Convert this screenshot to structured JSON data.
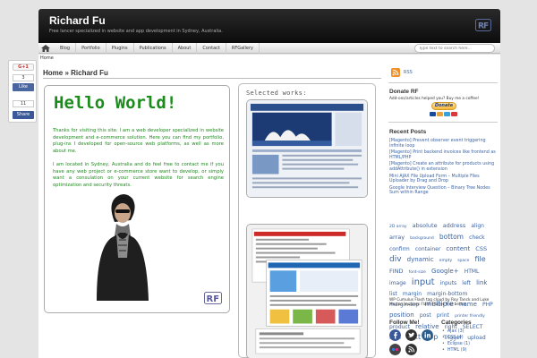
{
  "header": {
    "title": "Richard Fu",
    "tagline": "Free lancer specialized in website and app development in Sydney, Australia."
  },
  "nav": {
    "items": [
      "Blog",
      "Portfolio",
      "Plugins",
      "Publications",
      "About",
      "Contact",
      "RFGallery"
    ],
    "search_placeholder": "Type text to search here..."
  },
  "breadcrumb": {
    "small": "Home"
  },
  "share": {
    "gplus_label": "G+1",
    "gplus_count": "3",
    "like_label": "Like",
    "like_count": "11",
    "share_label": "Share"
  },
  "main": {
    "heading": "Home » Richard Fu",
    "hello_title": "Hello World!",
    "paragraph1": "Thanks for visiting this site. I am a web developer specialized in website development and e-commerce solution. Here you can find my portfolio, plug-ins I developed for open-source web platforms, as well as more about me.",
    "paragraph2": "I am located in Sydney, Australia and do feel free to contact me if you have any web project or e-commerce store want to develop, or simply want a consulation on your current website for search engine optimization and security threats."
  },
  "works": {
    "title": "Selected works:"
  },
  "sidebar": {
    "rss_label": "RSS",
    "donate_title": "Donate RF",
    "donate_sub": "Add-ons/articles helped you? Buy me a coffee!",
    "donate_button": "Donate",
    "recent_title": "Recent Posts",
    "recent_posts": [
      "[Magento] Prevent observer event triggering infinite loop",
      "[Magento] Print backend invoices like frontend as HTML/PHP",
      "[Magento] Create an attribute for products using addAttribute() in extension",
      "Mini AJAX File Upload Form – Multiple Files Uploader by Drag and Drop",
      "Google Interview Question – Binary Tree Nodes Sum within Range"
    ],
    "tags": [
      {
        "t": "2D array",
        "s": 4.5
      },
      {
        "t": "absolute",
        "s": 6.5
      },
      {
        "t": "address",
        "s": 6.5
      },
      {
        "t": "align",
        "s": 6
      },
      {
        "t": "array",
        "s": 6.5
      },
      {
        "t": "background",
        "s": 4.5
      },
      {
        "t": "bottom",
        "s": 7.5
      },
      {
        "t": "check",
        "s": 6
      },
      {
        "t": "confirm",
        "s": 6
      },
      {
        "t": "container",
        "s": 6
      },
      {
        "t": "content",
        "s": 7
      },
      {
        "t": "CSS",
        "s": 6.5
      },
      {
        "t": "div",
        "s": 9
      },
      {
        "t": "dynamic",
        "s": 7
      },
      {
        "t": "empty",
        "s": 4.5
      },
      {
        "t": "space",
        "s": 4.5
      },
      {
        "t": "file",
        "s": 8
      },
      {
        "t": "FIND",
        "s": 6.5
      },
      {
        "t": "font-size",
        "s": 4.5
      },
      {
        "t": "Google+",
        "s": 7
      },
      {
        "t": "HTML",
        "s": 6
      },
      {
        "t": "image",
        "s": 6
      },
      {
        "t": "input",
        "s": 10
      },
      {
        "t": "inputs",
        "s": 6
      },
      {
        "t": "left",
        "s": 6
      },
      {
        "t": "link",
        "s": 7
      },
      {
        "t": "list",
        "s": 6
      },
      {
        "t": "margin",
        "s": 6
      },
      {
        "t": "margin-bottom",
        "s": 6
      },
      {
        "t": "margin-top",
        "s": 6
      },
      {
        "t": "multiple",
        "s": 8
      },
      {
        "t": "name",
        "s": 7
      },
      {
        "t": "PHP",
        "s": 6
      },
      {
        "t": "position",
        "s": 7
      },
      {
        "t": "post",
        "s": 6
      },
      {
        "t": "print",
        "s": 6
      },
      {
        "t": "printer friendly",
        "s": 4.5
      },
      {
        "t": "product",
        "s": 6
      },
      {
        "t": "relative",
        "s": 7
      },
      {
        "t": "right",
        "s": 6
      },
      {
        "t": "SELECT",
        "s": 6
      },
      {
        "t": "space",
        "s": 4.5
      },
      {
        "t": "text",
        "s": 8
      },
      {
        "t": "top",
        "s": 8
      },
      {
        "t": "Trigger",
        "s": 6
      },
      {
        "t": "upload",
        "s": 6
      }
    ],
    "cumulus": "WP Cumulus Flash tag cloud by Roy Tanck and Luke Morton requires Flash Player 9 or better.",
    "follow_title": "Follow Me!",
    "categories_title": "Categories",
    "categories": [
      "Ajax (3)",
      "CSS (4)",
      "Eclipse (1)",
      "HTML (9)"
    ]
  },
  "colors": {
    "hello_green": "#1b8c1b",
    "link_blue": "#3a64a6",
    "rss_orange": "#f0902a",
    "header_dark": "#111111"
  },
  "icons": [
    "home-icon",
    "rss-icon",
    "rf-logo-icon",
    "facebook-icon",
    "twitter-icon",
    "linkedin-icon"
  ]
}
